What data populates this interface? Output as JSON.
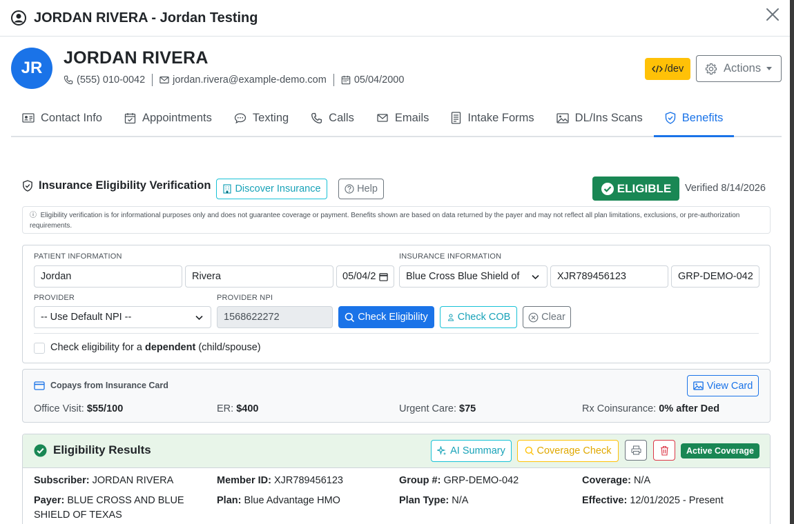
{
  "modal": {
    "title": "JORDAN RIVERA - Jordan Testing"
  },
  "patient": {
    "initials": "JR",
    "name": "JORDAN RIVERA",
    "phone": "(555) 010-0042",
    "email": "jordan.rivera@example-demo.com",
    "dob": "05/04/2000"
  },
  "header_buttons": {
    "dev": "/dev",
    "actions": "Actions"
  },
  "tabs": [
    {
      "label": "Contact Info",
      "icon": "contact-card-icon"
    },
    {
      "label": "Appointments",
      "icon": "calendar-check-icon"
    },
    {
      "label": "Texting",
      "icon": "chat-icon"
    },
    {
      "label": "Calls",
      "icon": "phone-icon"
    },
    {
      "label": "Emails",
      "icon": "envelope-icon"
    },
    {
      "label": "Intake Forms",
      "icon": "document-icon"
    },
    {
      "label": "DL/Ins Scans",
      "icon": "image-icon"
    },
    {
      "label": "Benefits",
      "icon": "shield-check-icon",
      "active": true
    }
  ],
  "eligibility": {
    "title": "Insurance Eligibility Verification",
    "discover_label": "Discover Insurance",
    "help_label": "Help",
    "status": "ELIGIBLE",
    "verified": "Verified 8/14/2026",
    "disclaimer": "Eligibility verification is for informational purposes only and does not guarantee coverage or payment. Benefits shown are based on data returned by the payer and may not reflect all plan limitations, exclusions, or pre-authorization requirements."
  },
  "form": {
    "patient_label": "PATIENT INFORMATION",
    "first_name": "Jordan",
    "last_name": "Rivera",
    "dob": "05/04/2",
    "insurance_label": "INSURANCE INFORMATION",
    "payer": "Blue Cross Blue Shield of Te",
    "member_id": "XJR789456123",
    "group": "GRP-DEMO-042",
    "provider_label": "PROVIDER",
    "provider": "-- Use Default NPI --",
    "npi_label": "PROVIDER NPI",
    "npi": "1568622272",
    "check_eligibility": "Check Eligibility",
    "check_cob": "Check COB",
    "clear": "Clear",
    "dependent_prefix": "Check eligibility for a ",
    "dependent_bold": "dependent",
    "dependent_suffix": " (child/spouse)"
  },
  "copays": {
    "title": "Copays from Insurance Card",
    "view_card": "View Card",
    "items": [
      {
        "label": "Office Visit:",
        "value": "$55/100"
      },
      {
        "label": "ER:",
        "value": "$400"
      },
      {
        "label": "Urgent Care:",
        "value": "$75"
      },
      {
        "label": "Rx Coinsurance:",
        "value": "0% after Ded"
      }
    ]
  },
  "results": {
    "title": "Eligibility Results",
    "ai_summary": "AI Summary",
    "coverage_check": "Coverage Check",
    "badge": "Active Coverage",
    "fields": {
      "subscriber_label": "Subscriber:",
      "subscriber": "JORDAN RIVERA",
      "member_label": "Member ID:",
      "member": "XJR789456123",
      "group_label": "Group #:",
      "group": "GRP-DEMO-042",
      "coverage_label": "Coverage:",
      "coverage": "N/A",
      "payer_label": "Payer:",
      "payer_line1": "BLUE CROSS AND BLUE",
      "payer_line2": "SHIELD OF TEXAS",
      "plan_label": "Plan:",
      "plan": "Blue Advantage HMO",
      "plan_type_label": "Plan Type:",
      "plan_type": "N/A",
      "effective_label": "Effective:",
      "effective": "12/01/2025 - Present"
    }
  },
  "colors": {
    "primary": "#1a73e8",
    "success": "#198754",
    "warning": "#ffc107",
    "info": "#17a2b8"
  }
}
